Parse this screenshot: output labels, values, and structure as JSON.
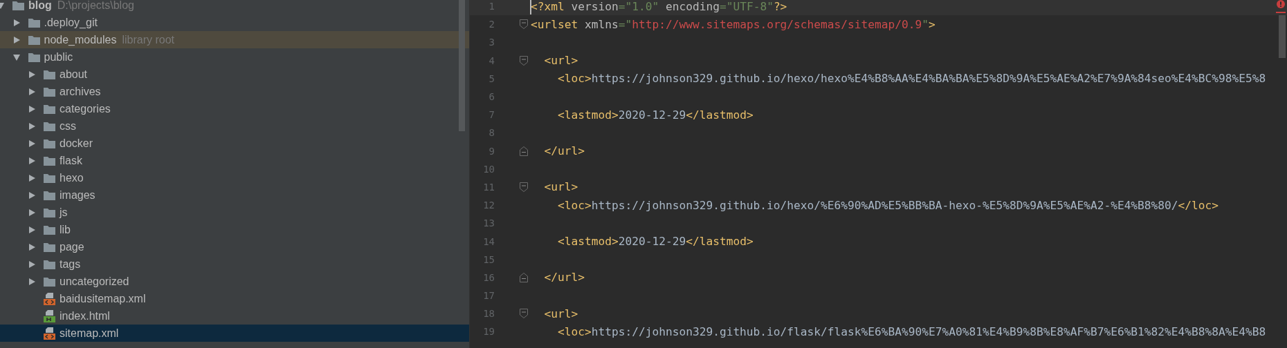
{
  "project_tree": {
    "items": [
      {
        "name": "blog",
        "hint": "D:\\projects\\blog",
        "kind": "folder",
        "root": true,
        "expanded": true,
        "selected": false,
        "highlighted": false,
        "children": [
          {
            "name": ".deploy_git",
            "kind": "folder",
            "expanded": false,
            "selected": false,
            "highlighted": false
          },
          {
            "name": "node_modules",
            "hint": "library root",
            "kind": "folder",
            "expanded": false,
            "selected": false,
            "highlighted": true
          },
          {
            "name": "public",
            "kind": "folder",
            "expanded": true,
            "selected": false,
            "highlighted": false,
            "children": [
              {
                "name": "about",
                "kind": "folder",
                "expanded": false,
                "selected": false,
                "highlighted": false
              },
              {
                "name": "archives",
                "kind": "folder",
                "expanded": false,
                "selected": false,
                "highlighted": false
              },
              {
                "name": "categories",
                "kind": "folder",
                "expanded": false,
                "selected": false,
                "highlighted": false
              },
              {
                "name": "css",
                "kind": "folder",
                "expanded": false,
                "selected": false,
                "highlighted": false
              },
              {
                "name": "docker",
                "kind": "folder",
                "expanded": false,
                "selected": false,
                "highlighted": false
              },
              {
                "name": "flask",
                "kind": "folder",
                "expanded": false,
                "selected": false,
                "highlighted": false
              },
              {
                "name": "hexo",
                "kind": "folder",
                "expanded": false,
                "selected": false,
                "highlighted": false
              },
              {
                "name": "images",
                "kind": "folder",
                "expanded": false,
                "selected": false,
                "highlighted": false
              },
              {
                "name": "js",
                "kind": "folder",
                "expanded": false,
                "selected": false,
                "highlighted": false
              },
              {
                "name": "lib",
                "kind": "folder",
                "expanded": false,
                "selected": false,
                "highlighted": false
              },
              {
                "name": "page",
                "kind": "folder",
                "expanded": false,
                "selected": false,
                "highlighted": false
              },
              {
                "name": "tags",
                "kind": "folder",
                "expanded": false,
                "selected": false,
                "highlighted": false
              },
              {
                "name": "uncategorized",
                "kind": "folder",
                "expanded": false,
                "selected": false,
                "highlighted": false
              },
              {
                "name": "baidusitemap.xml",
                "kind": "xml",
                "selected": false,
                "highlighted": false
              },
              {
                "name": "index.html",
                "kind": "html",
                "selected": false,
                "highlighted": false
              },
              {
                "name": "sitemap.xml",
                "kind": "xml",
                "selected": true,
                "highlighted": false
              }
            ]
          }
        ]
      }
    ]
  },
  "editor": {
    "lines": [
      {
        "number": "1",
        "kind": "plain",
        "current": true,
        "segments": [
          {
            "kind": "tag",
            "text": "<?xml"
          },
          {
            "kind": "attr",
            "text": " version"
          },
          {
            "kind": "value",
            "text": "=\"1.0\""
          },
          {
            "kind": "attr",
            "text": " encoding"
          },
          {
            "kind": "value",
            "text": "=\"UTF-8\""
          },
          {
            "kind": "tag",
            "text": "?>"
          }
        ]
      },
      {
        "number": "2",
        "kind": "fold_start",
        "current": false,
        "segments": [
          {
            "kind": "tag",
            "text": "<urlset"
          },
          {
            "kind": "attr",
            "text": " xmlns"
          },
          {
            "kind": "value",
            "text": "=\""
          },
          {
            "kind": "url",
            "text": "http://www.sitemaps.org/schemas/sitemap/0.9"
          },
          {
            "kind": "value",
            "text": "\""
          },
          {
            "kind": "tag",
            "text": ">"
          }
        ]
      },
      {
        "number": "3",
        "kind": "plain",
        "current": false
      },
      {
        "number": "4",
        "kind": "fold_start",
        "current": false,
        "segments": [
          {
            "kind": "tag",
            "text": "  <url>"
          }
        ]
      },
      {
        "number": "5",
        "kind": "plain",
        "current": false,
        "segments": [
          {
            "kind": "tag",
            "text": "    <loc>"
          },
          {
            "kind": "text",
            "text": "https://johnson329.github.io/hexo/hexo%E4%B8%AA%E4%BA%BA%E5%8D%9A%E5%AE%A2%E7%9A%84seo%E4%BC%98%E5%8"
          }
        ]
      },
      {
        "number": "6",
        "kind": "plain",
        "current": false
      },
      {
        "number": "7",
        "kind": "plain",
        "current": false,
        "segments": [
          {
            "kind": "tag",
            "text": "    <lastmod>"
          },
          {
            "kind": "text",
            "text": "2020-12-29"
          },
          {
            "kind": "tag",
            "text": "</lastmod>"
          }
        ]
      },
      {
        "number": "8",
        "kind": "plain",
        "current": false
      },
      {
        "number": "9",
        "kind": "fold_end",
        "current": false,
        "segments": [
          {
            "kind": "tag",
            "text": "  </url>"
          }
        ]
      },
      {
        "number": "10",
        "kind": "plain",
        "current": false
      },
      {
        "number": "11",
        "kind": "fold_start",
        "current": false,
        "segments": [
          {
            "kind": "tag",
            "text": "  <url>"
          }
        ]
      },
      {
        "number": "12",
        "kind": "plain",
        "current": false,
        "segments": [
          {
            "kind": "tag",
            "text": "    <loc>"
          },
          {
            "kind": "text",
            "text": "https://johnson329.github.io/hexo/%E6%90%AD%E5%BB%BA-hexo-%E5%8D%9A%E5%AE%A2-%E4%B8%80/"
          },
          {
            "kind": "tag",
            "text": "</loc>"
          }
        ]
      },
      {
        "number": "13",
        "kind": "plain",
        "current": false
      },
      {
        "number": "14",
        "kind": "plain",
        "current": false,
        "segments": [
          {
            "kind": "tag",
            "text": "    <lastmod>"
          },
          {
            "kind": "text",
            "text": "2020-12-29"
          },
          {
            "kind": "tag",
            "text": "</lastmod>"
          }
        ]
      },
      {
        "number": "15",
        "kind": "plain",
        "current": false
      },
      {
        "number": "16",
        "kind": "fold_end",
        "current": false,
        "segments": [
          {
            "kind": "tag",
            "text": "  </url>"
          }
        ]
      },
      {
        "number": "17",
        "kind": "plain",
        "current": false
      },
      {
        "number": "18",
        "kind": "fold_start",
        "current": false,
        "segments": [
          {
            "kind": "tag",
            "text": "  <url>"
          }
        ]
      },
      {
        "number": "19",
        "kind": "plain",
        "current": false,
        "segments": [
          {
            "kind": "tag",
            "text": "    <loc>"
          },
          {
            "kind": "text",
            "text": "https://johnson329.github.io/flask/flask%E6%BA%90%E7%A0%81%E4%B9%8B%E8%AF%B7%E6%B1%82%E4%B8%8A%E4%B8"
          }
        ]
      }
    ]
  }
}
